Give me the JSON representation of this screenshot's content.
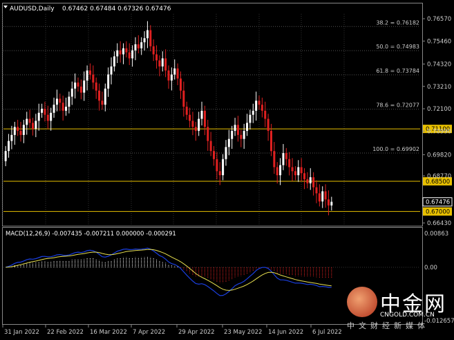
{
  "header": {
    "symbol": "AUDUSD,Daily",
    "ohlc": "0.67462 0.67484 0.67326 0.67476"
  },
  "fib_levels": [
    {
      "label": "38.2 = 0.76182",
      "price": 0.76182
    },
    {
      "label": "50.0 = 0.74983",
      "price": 0.74983
    },
    {
      "label": "61.8 = 0.73784",
      "price": 0.73784
    },
    {
      "label": "78.6 = 0.72077",
      "price": 0.72077
    },
    {
      "label": "100.0 = 0.69902",
      "price": 0.69902
    }
  ],
  "hlines": [
    {
      "label": "0.71100",
      "price": 0.711
    },
    {
      "label": "0.68500",
      "price": 0.685
    },
    {
      "label": "0.67000",
      "price": 0.67
    }
  ],
  "price_axis": [
    "0.76570",
    "0.75460",
    "0.74320",
    "0.73210",
    "0.72100",
    "0.70990",
    "0.69820",
    "0.68770",
    "0.66430"
  ],
  "current_price": {
    "label": "0.67476",
    "price": 0.67476
  },
  "macd": {
    "label": "MACD(12,26,9) -0.007435 -0.007211 0.000000 -0.000291",
    "axis": [
      "0.00863",
      "0.00",
      "-0.012657"
    ]
  },
  "x_axis": [
    "31 Jan 2022",
    "22 Feb 2022",
    "16 Mar 2022",
    "7 Apr 2022",
    "29 Apr 2022",
    "23 May 2022",
    "14 Jun 2022",
    "6 Jul 2022"
  ],
  "watermark": {
    "brand": "中金网",
    "url": "CNGOLD.COM.CN",
    "sub": "中文财经新媒体"
  },
  "colors": {
    "bull": "#ffffff",
    "bear": "#e02020",
    "level_line": "#e8c000",
    "macd_signal": "#e8e050",
    "macd_line": "#1a3fe0",
    "hist_pos": "#ffffff",
    "hist_neg": "#e02020"
  },
  "chart_data": {
    "type": "candlestick",
    "closes": [
      0.7,
      0.705,
      0.708,
      0.712,
      0.71,
      0.708,
      0.713,
      0.716,
      0.714,
      0.711,
      0.715,
      0.719,
      0.721,
      0.718,
      0.715,
      0.719,
      0.723,
      0.726,
      0.724,
      0.72,
      0.722,
      0.727,
      0.731,
      0.734,
      0.732,
      0.729,
      0.735,
      0.74,
      0.738,
      0.734,
      0.73,
      0.725,
      0.723,
      0.731,
      0.738,
      0.742,
      0.747,
      0.75,
      0.748,
      0.751,
      0.749,
      0.746,
      0.75,
      0.753,
      0.751,
      0.754,
      0.756,
      0.76,
      0.752,
      0.748,
      0.745,
      0.742,
      0.746,
      0.74,
      0.735,
      0.738,
      0.741,
      0.736,
      0.73,
      0.722,
      0.718,
      0.715,
      0.712,
      0.71,
      0.716,
      0.72,
      0.712,
      0.705,
      0.7,
      0.696,
      0.69,
      0.688,
      0.696,
      0.702,
      0.706,
      0.71,
      0.713,
      0.708,
      0.706,
      0.71,
      0.714,
      0.718,
      0.72,
      0.725,
      0.723,
      0.72,
      0.716,
      0.71,
      0.7,
      0.692,
      0.688,
      0.693,
      0.699,
      0.696,
      0.692,
      0.69,
      0.688,
      0.692,
      0.689,
      0.686,
      0.684,
      0.687,
      0.682,
      0.679,
      0.675,
      0.68,
      0.676,
      0.673,
      0.6748
    ]
  }
}
